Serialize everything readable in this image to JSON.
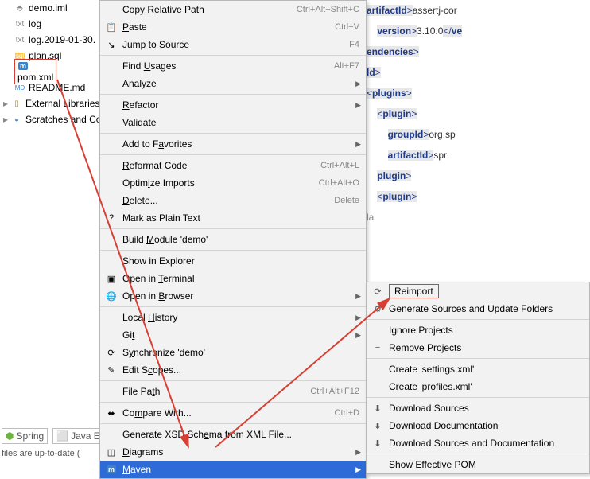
{
  "tree": {
    "items": [
      {
        "label": "demo.iml",
        "icon": "iml"
      },
      {
        "label": "log",
        "icon": "log"
      },
      {
        "label": "log.2019-01-30.",
        "icon": "log"
      },
      {
        "label": "plan.sql",
        "icon": "sql"
      },
      {
        "label": "pom.xml",
        "icon": "xml",
        "selected": true
      },
      {
        "label": "README.md",
        "icon": "md"
      }
    ],
    "roots": [
      {
        "label": "External Libraries",
        "icon": "lib"
      },
      {
        "label": "Scratches and Cons",
        "icon": "scratch"
      }
    ]
  },
  "menu1": [
    {
      "label": "Copy Relative Path",
      "shortcut": "Ctrl+Alt+Shift+C",
      "u": 5
    },
    {
      "label": "Paste",
      "shortcut": "Ctrl+V",
      "icon": "📋",
      "u": 0
    },
    {
      "label": "Jump to Source",
      "shortcut": "F4",
      "icon": "↘"
    },
    "-",
    {
      "label": "Find Usages",
      "shortcut": "Alt+F7",
      "u": 5
    },
    {
      "label": "Analyze",
      "sub": true,
      "u": 5
    },
    "-",
    {
      "label": "Refactor",
      "sub": true,
      "u": 0
    },
    {
      "label": "Validate"
    },
    "-",
    {
      "label": "Add to Favorites",
      "sub": true,
      "u": 8
    },
    "-",
    {
      "label": "Reformat Code",
      "shortcut": "Ctrl+Alt+L",
      "u": 0
    },
    {
      "label": "Optimize Imports",
      "shortcut": "Ctrl+Alt+O",
      "u": 5
    },
    {
      "label": "Delete...",
      "shortcut": "Delete",
      "u": 0
    },
    {
      "label": "Mark as Plain Text",
      "icon": "?"
    },
    "-",
    {
      "label": "Build Module 'demo'",
      "u": 6
    },
    "-",
    {
      "label": "Show in Explorer"
    },
    {
      "label": "Open in Terminal",
      "icon": "▣",
      "u": 8
    },
    {
      "label": "Open in Browser",
      "sub": true,
      "icon": "🌐",
      "u": 8
    },
    "-",
    {
      "label": "Local History",
      "sub": true,
      "u": 6
    },
    {
      "label": "Git",
      "sub": true,
      "u": 2
    },
    {
      "label": "Synchronize 'demo'",
      "icon": "⟳",
      "u": 1
    },
    {
      "label": "Edit Scopes...",
      "icon": "✎",
      "u": 6
    },
    "-",
    {
      "label": "File Path",
      "shortcut": "Ctrl+Alt+F12",
      "u": 7
    },
    "-",
    {
      "label": "Compare With...",
      "shortcut": "Ctrl+D",
      "icon": "⬌",
      "u": 2
    },
    "-",
    {
      "label": "Generate XSD Schema from XML File...",
      "u": 16
    },
    {
      "label": "Diagrams",
      "sub": true,
      "icon": "◫",
      "u": 0
    },
    {
      "label": "Maven",
      "sub": true,
      "sel": true,
      "icon": "m",
      "u": 0
    }
  ],
  "menu2": [
    {
      "label": "Reimport",
      "icon": "⟳",
      "boxed": true
    },
    {
      "label": "Generate Sources and Update Folders",
      "icon": "⚙"
    },
    "-",
    {
      "label": "Ignore Projects"
    },
    {
      "label": "Remove Projects",
      "icon": "−"
    },
    "-",
    {
      "label": "Create 'settings.xml'"
    },
    {
      "label": "Create 'profiles.xml'"
    },
    "-",
    {
      "label": "Download Sources",
      "icon": "⬇"
    },
    {
      "label": "Download Documentation",
      "icon": "⬇"
    },
    {
      "label": "Download Sources and Documentation",
      "icon": "⬇"
    },
    "-",
    {
      "label": "Show Effective POM"
    }
  ],
  "status": {
    "spring": "Spring",
    "java": "Java Enter"
  },
  "bottom": "files are up-to-date (",
  "editor": {
    "lines": [
      {
        "pre": "",
        "open": "artifactId",
        "txt": "assertj-cor",
        "cut": true
      },
      {
        "pre": "    ",
        "open": "version",
        "txt": "3.10.0",
        "close": "ve",
        "cut": true
      },
      {
        "pre": "",
        "close2": "endencies"
      },
      {
        "pre": "",
        "close2": "ld"
      },
      {
        "pre": "",
        "open": "plugins",
        "selfclose": true
      },
      {
        "pre": "    ",
        "open": "plugin",
        "selfclose": true
      },
      {
        "pre": "        ",
        "open": "groupId",
        "txt": "org.sp",
        "cut": true
      },
      {
        "pre": "        ",
        "open": "artifactId",
        "txt": "spr",
        "cut": true
      },
      {
        "pre": "    ",
        "close2": "plugin"
      },
      {
        "pre": "    ",
        "open": "plugin",
        "selfclose": true
      },
      {
        "pre": "",
        "dots": "la"
      }
    ]
  }
}
